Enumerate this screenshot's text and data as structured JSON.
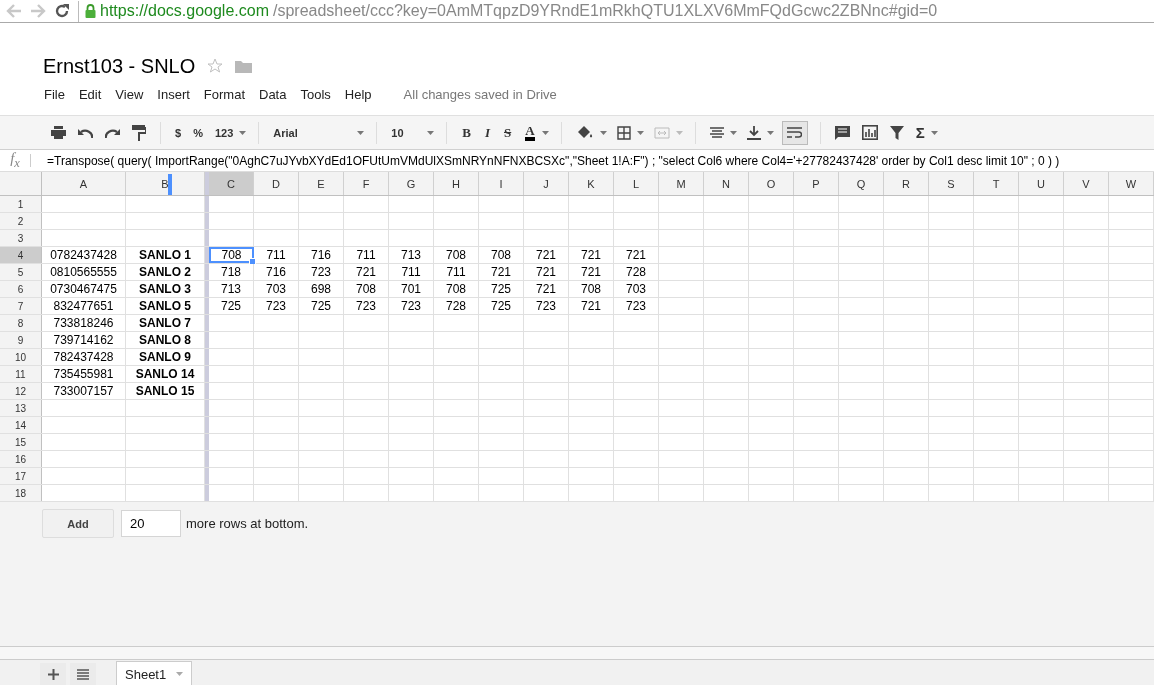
{
  "browser": {
    "url_origin": "https://docs.google.com",
    "url_path": "/spreadsheet/ccc?key=0AmMTqpzD9YRndE1mRkhQTU1XLXV6MmFQdGcwc2ZBNnc#gid=0"
  },
  "document": {
    "title": "Ernst103 - SNLO",
    "starred": false
  },
  "menu": [
    "File",
    "Edit",
    "View",
    "Insert",
    "Format",
    "Data",
    "Tools",
    "Help"
  ],
  "save_status": "All changes saved in Drive",
  "toolbar": {
    "currency": "$",
    "percent": "%",
    "number_format": "123",
    "font": "Arial",
    "font_size": "10",
    "bold": "B",
    "italic": "I",
    "strikethrough": "S",
    "text_color": "A",
    "functions": "Σ"
  },
  "formula_bar": {
    "label": "f$_{x}$",
    "formula": "=Transpose( query( ImportRange(\"0AghC7uJYvbXYdEd1OFUtUmVMdUlXSmNRYnNFNXBCSXc\",\"Sheet 1!A:F\") ; \"select Col6 where Col4='+27782437428' order by Col1 desc limit 10\" ; 0 ) )"
  },
  "grid": {
    "columns": [
      {
        "label": "A",
        "selected": false
      },
      {
        "label": "B",
        "selected": false
      },
      {
        "label": "C",
        "selected": true
      },
      {
        "label": "D",
        "selected": false
      },
      {
        "label": "E",
        "selected": false
      },
      {
        "label": "F",
        "selected": false
      },
      {
        "label": "G",
        "selected": false
      },
      {
        "label": "H",
        "selected": false
      },
      {
        "label": "I",
        "selected": false
      },
      {
        "label": "J",
        "selected": false
      },
      {
        "label": "K",
        "selected": false
      },
      {
        "label": "L",
        "selected": false
      },
      {
        "label": "M",
        "selected": false
      },
      {
        "label": "N",
        "selected": false
      },
      {
        "label": "O",
        "selected": false
      },
      {
        "label": "P",
        "selected": false
      },
      {
        "label": "Q",
        "selected": false
      },
      {
        "label": "R",
        "selected": false
      },
      {
        "label": "S",
        "selected": false
      },
      {
        "label": "T",
        "selected": false
      },
      {
        "label": "U",
        "selected": false
      },
      {
        "label": "V",
        "selected": false
      },
      {
        "label": "W",
        "selected": false
      }
    ],
    "rows": [
      {
        "number": "1",
        "selected": false
      },
      {
        "number": "2",
        "selected": false
      },
      {
        "number": "3",
        "selected": false
      },
      {
        "number": "4",
        "selected": true,
        "cells": [
          "0782437428",
          "SANLO 1",
          "708",
          "711",
          "716",
          "711",
          "713",
          "708",
          "708",
          "721",
          "721",
          "721"
        ]
      },
      {
        "number": "5",
        "selected": false,
        "cells": [
          "0810565555",
          "SANLO 2",
          "718",
          "716",
          "723",
          "721",
          "711",
          "711",
          "721",
          "721",
          "721",
          "728"
        ]
      },
      {
        "number": "6",
        "selected": false,
        "cells": [
          "0730467475",
          "SANLO 3",
          "713",
          "703",
          "698",
          "708",
          "701",
          "708",
          "725",
          "721",
          "708",
          "703"
        ]
      },
      {
        "number": "7",
        "selected": false,
        "cells": [
          "832477651",
          "SANLO 5",
          "725",
          "723",
          "725",
          "723",
          "723",
          "728",
          "725",
          "723",
          "721",
          "723"
        ]
      },
      {
        "number": "8",
        "selected": false,
        "cells": [
          "733818246",
          "SANLO 7"
        ]
      },
      {
        "number": "9",
        "selected": false,
        "cells": [
          "739714162",
          "SANLO 8"
        ]
      },
      {
        "number": "10",
        "selected": false,
        "cells": [
          "782437428",
          "SANLO 9"
        ]
      },
      {
        "number": "11",
        "selected": false,
        "cells": [
          "735455981",
          "SANLO 14"
        ]
      },
      {
        "number": "12",
        "selected": false,
        "cells": [
          "733007157",
          "SANLO 15"
        ]
      },
      {
        "number": "13",
        "selected": false
      },
      {
        "number": "14",
        "selected": false
      },
      {
        "number": "15",
        "selected": false
      },
      {
        "number": "16",
        "selected": false
      },
      {
        "number": "17",
        "selected": false
      },
      {
        "number": "18",
        "selected": false
      }
    ]
  },
  "add_rows": {
    "button": "Add",
    "value": "20",
    "suffix": "more rows at bottom."
  },
  "sheet_tabs": [
    {
      "label": "Sheet1",
      "selected": true
    }
  ]
}
